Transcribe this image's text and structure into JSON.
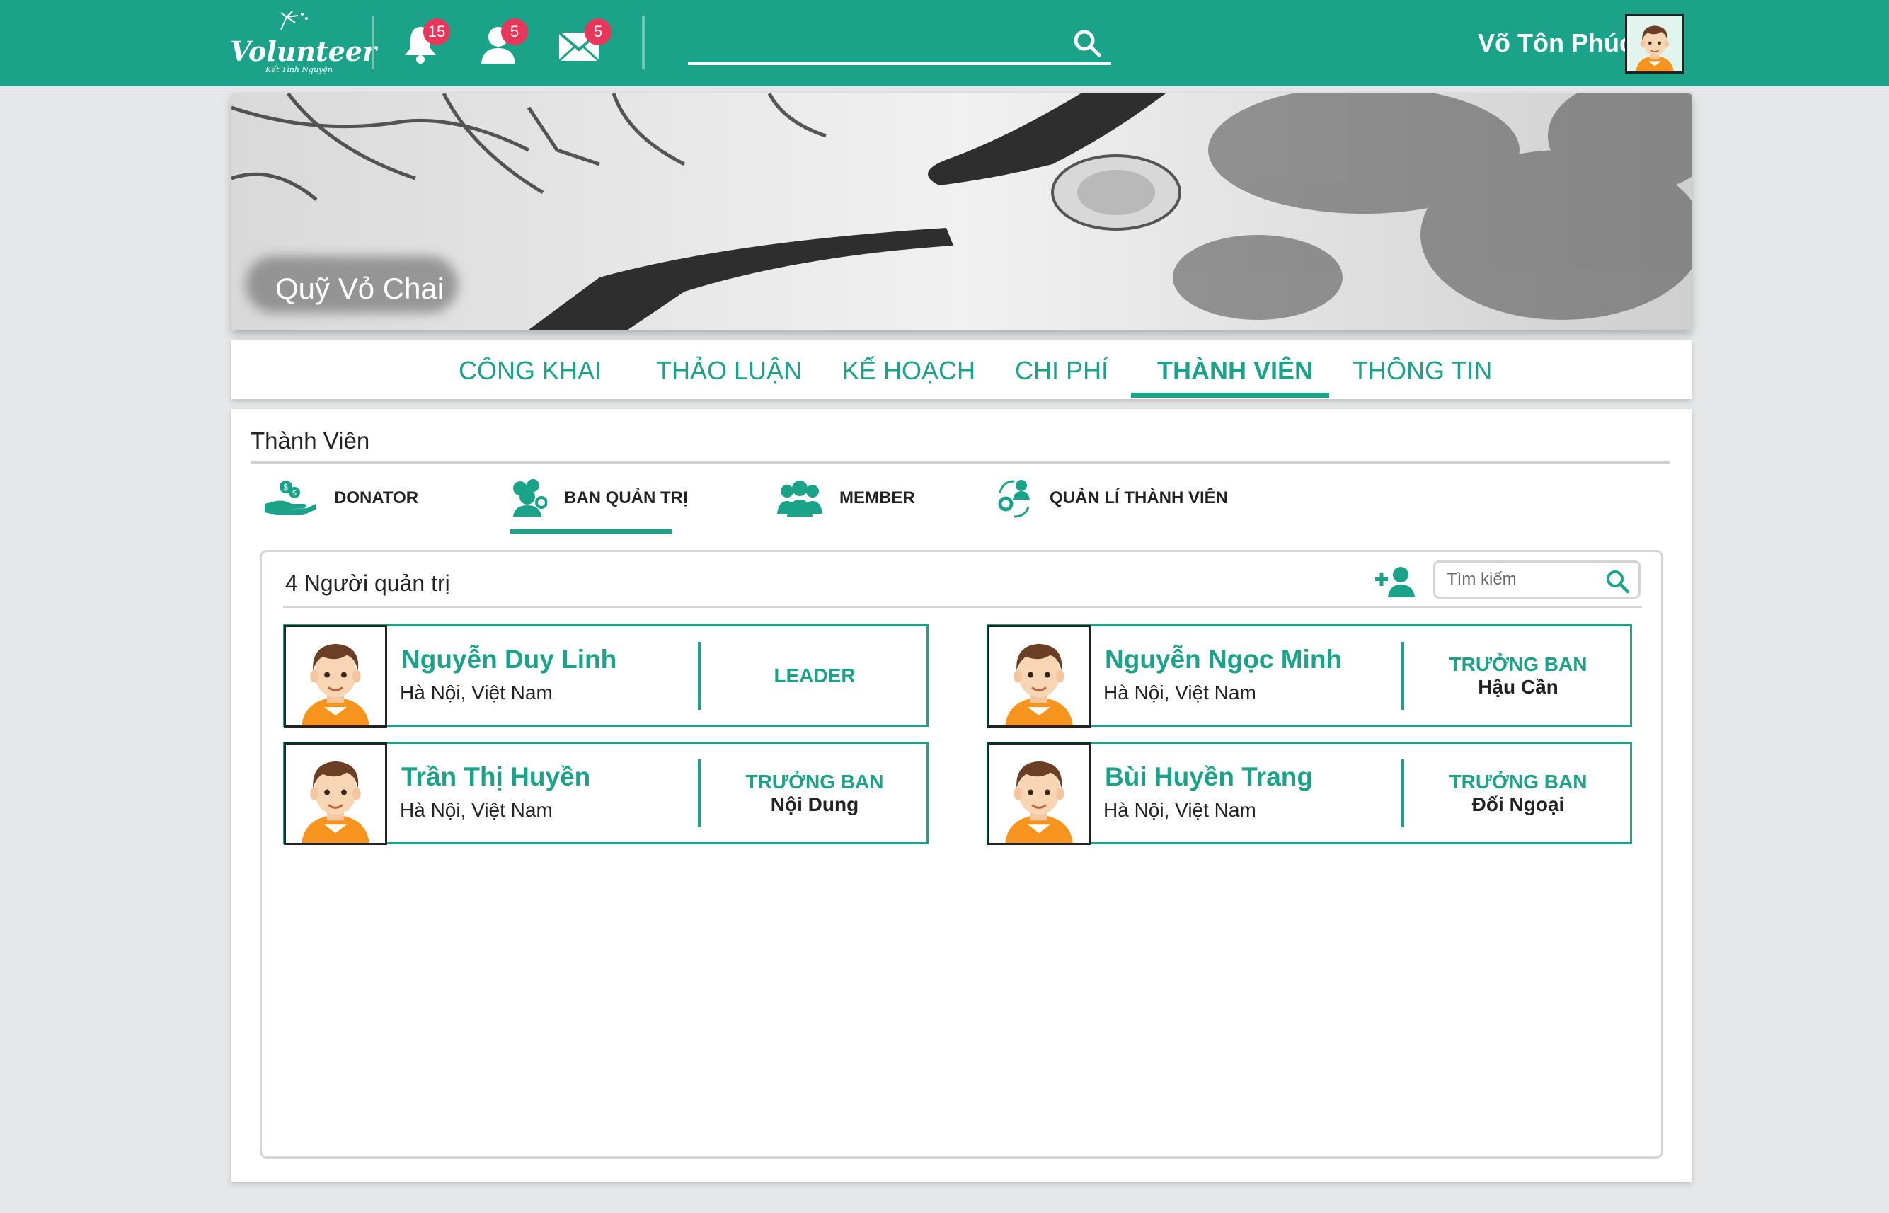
{
  "header": {
    "logo_text": "Volunteer",
    "logo_tagline": "Kết Tình Nguyện",
    "notifications_badge": "15",
    "friend_requests_badge": "5",
    "messages_badge": "5",
    "search_placeholder": "",
    "user_name": "Võ Tôn Phúc"
  },
  "cover": {
    "title": "Quỹ Vỏ Chai"
  },
  "tabs": [
    {
      "label": "CÔNG KHAI"
    },
    {
      "label": "THẢO LUẬN"
    },
    {
      "label": "KẾ HOẠCH"
    },
    {
      "label": "CHI PHÍ"
    },
    {
      "label": "THÀNH VIÊN",
      "active": true
    },
    {
      "label": "THÔNG TIN"
    }
  ],
  "members": {
    "title": "Thành Viên",
    "subtabs": [
      {
        "label": "DONATOR",
        "icon": "donate-hand-icon"
      },
      {
        "label": "BAN QUẢN TRỊ",
        "icon": "admin-group-icon",
        "active": true
      },
      {
        "label": "MEMBER",
        "icon": "members-group-icon"
      },
      {
        "label": "QUẢN LÍ THÀNH VIÊN",
        "icon": "manage-members-icon"
      }
    ],
    "count_label": "4 Người quản trị",
    "search_placeholder": "Tìm kiếm",
    "cards": [
      {
        "name": "Nguyễn Duy Linh",
        "location": "Hà Nội, Việt Nam",
        "role_title": "LEADER",
        "role_dept": ""
      },
      {
        "name": "Nguyễn Ngọc Minh",
        "location": "Hà Nội, Việt Nam",
        "role_title": "TRƯỞNG BAN",
        "role_dept": "Hậu Cần"
      },
      {
        "name": "Trần Thị Huyền",
        "location": "Hà Nội, Việt Nam",
        "role_title": "TRƯỞNG BAN",
        "role_dept": "Nội Dung"
      },
      {
        "name": "Bùi Huyền Trang",
        "location": "Hà Nội, Việt Nam",
        "role_title": "TRƯỞNG BAN",
        "role_dept": "Đối Ngoại"
      }
    ]
  },
  "colors": {
    "primary": "#1ba38a",
    "badge": "#e8375a",
    "background": "#e6e7e8"
  }
}
